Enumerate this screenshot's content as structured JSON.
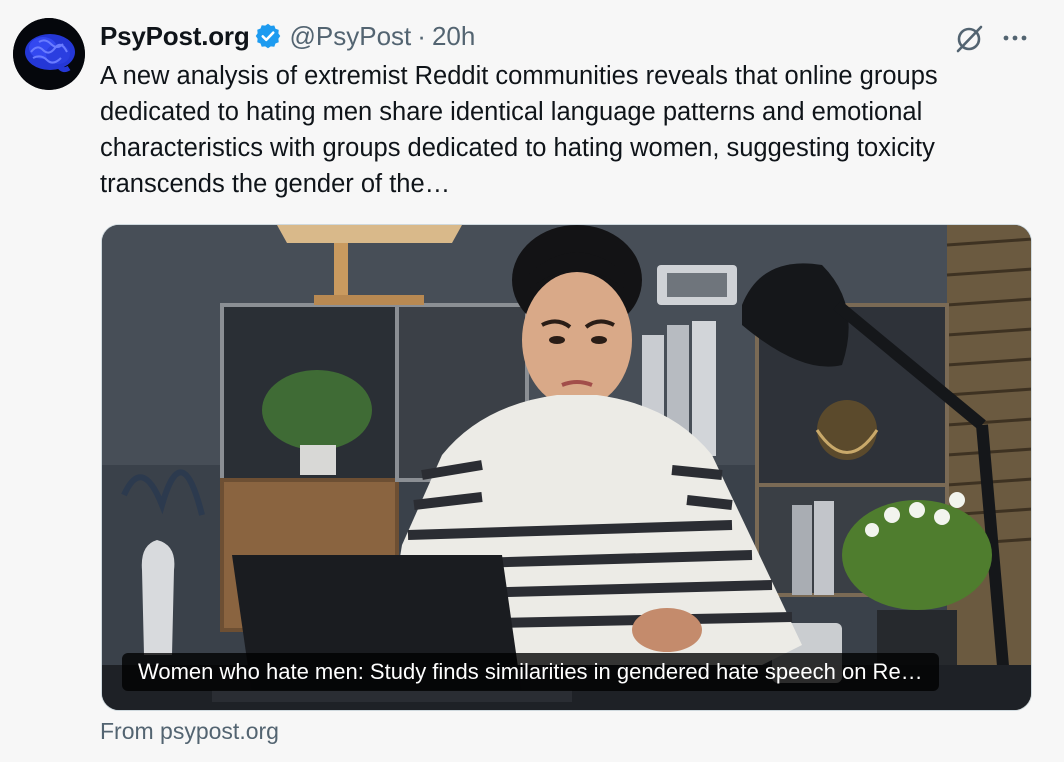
{
  "author": {
    "display_name": "PsyPost.org",
    "handle": "@PsyPost",
    "separator": "·",
    "time": "20h",
    "avatar_icon": "brain-logo-icon",
    "verified_icon": "verified-badge-icon",
    "verified_color": "#1d9bf0"
  },
  "tweet": {
    "text": "A new analysis of extremist Reddit communities reveals that online groups dedicated to hating men share identical language patterns and emotional characteristics with groups dedicated to hating women, suggesting toxicity transcends the gender of the…"
  },
  "actions": {
    "grok_icon": "grok-icon",
    "more_icon": "more-options-icon"
  },
  "card": {
    "title": "Women who hate men: Study finds similarities in gendered hate speech on Re…",
    "image": "photo-woman-at-laptop"
  },
  "source": {
    "text": "From psypost.org"
  },
  "colors": {
    "background": "#f7f7f7",
    "text_primary": "#0f1419",
    "text_secondary": "#536471"
  }
}
